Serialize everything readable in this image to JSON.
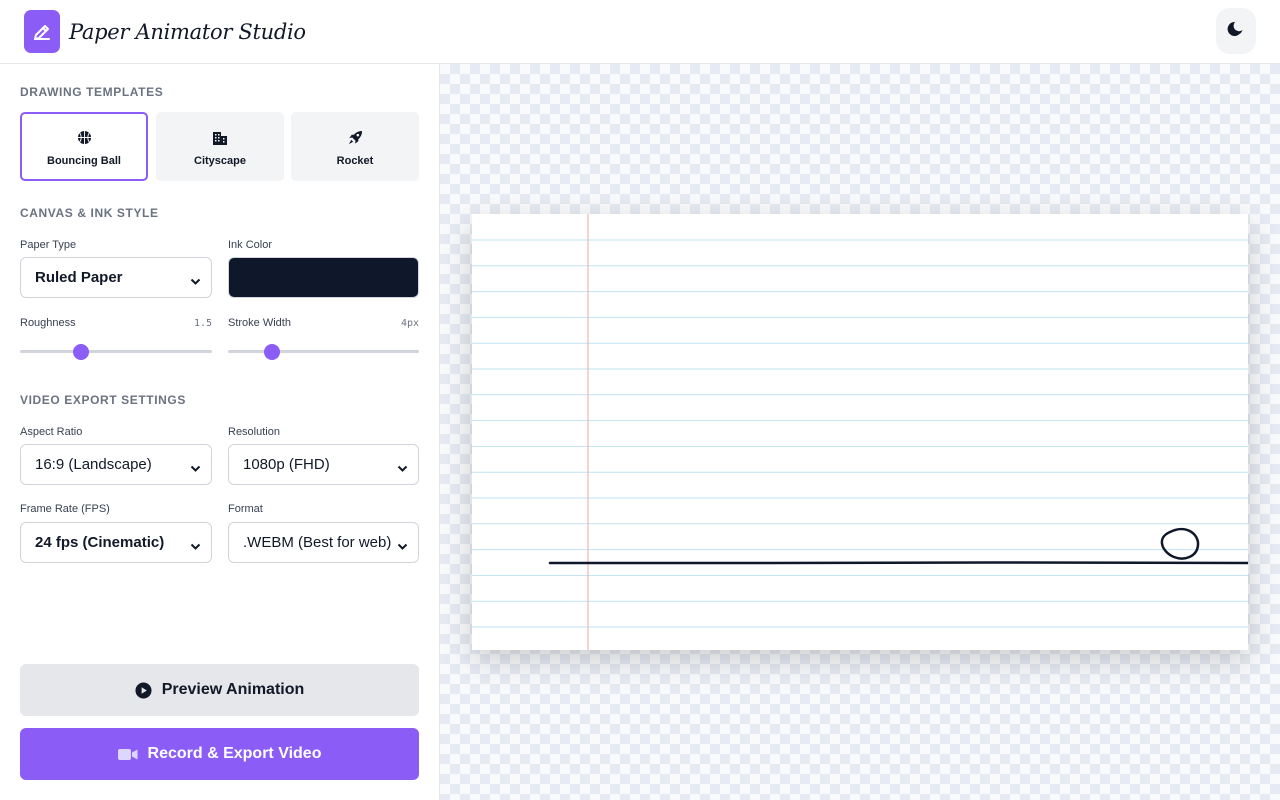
{
  "app": {
    "title": "Paper Animator Studio",
    "logo_icon": "pencil-icon",
    "theme_icon": "moon-icon"
  },
  "sections": {
    "templates": "DRAWING TEMPLATES",
    "canvas": "CANVAS & INK STYLE",
    "video": "VIDEO EXPORT SETTINGS"
  },
  "templates": [
    {
      "label": "Bouncing Ball",
      "icon": "basketball-icon",
      "active": true
    },
    {
      "label": "Cityscape",
      "icon": "building-icon",
      "active": false
    },
    {
      "label": "Rocket",
      "icon": "rocket-icon",
      "active": false
    }
  ],
  "canvas": {
    "paper_type_label": "Paper Type",
    "paper_type_value": "Ruled Paper",
    "ink_color_label": "Ink Color",
    "ink_color": "#0f172a",
    "roughness_label": "Roughness",
    "roughness_value": "1.5",
    "roughness_fraction": 0.32,
    "stroke_label": "Stroke Width",
    "stroke_value": "4px",
    "stroke_fraction": 0.23
  },
  "video": {
    "aspect_label": "Aspect Ratio",
    "aspect_value": "16:9 (Landscape)",
    "resolution_label": "Resolution",
    "resolution_value": "1080p (FHD)",
    "fps_label": "Frame Rate (FPS)",
    "fps_value": "24 fps (Cinematic)",
    "format_label": "Format",
    "format_value": ".WEBM (Best for web)"
  },
  "actions": {
    "preview_label": "Preview Animation",
    "record_label": "Record & Export Video"
  },
  "colors": {
    "accent": "#8b5cf6",
    "rule_line": "#bfe3f0",
    "margin_line": "#f3a5a5",
    "ink": "#0f172a"
  }
}
